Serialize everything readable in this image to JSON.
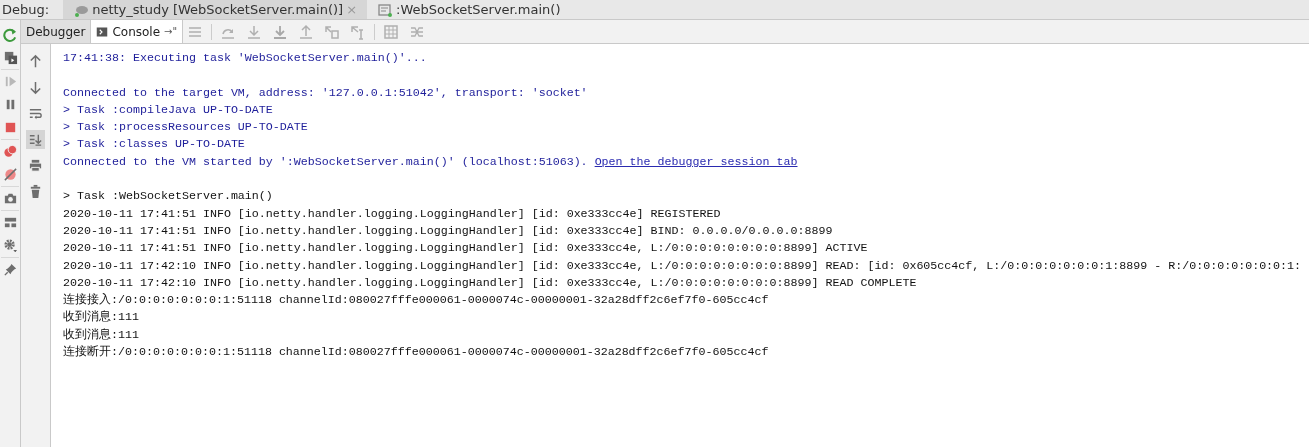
{
  "debug_bar": {
    "label": "Debug:",
    "tabs": [
      {
        "title": "netty_study [WebSocketServer.main()]",
        "selected": true,
        "close": "×"
      },
      {
        "title": ":WebSocketServer.main()",
        "selected": false
      }
    ]
  },
  "toolbar": {
    "tabs": [
      {
        "label": "Debugger",
        "selected": false
      },
      {
        "label": "Console",
        "selected": true,
        "pin": "→\""
      }
    ]
  },
  "gutter": {
    "scroll_to_end_on": true
  },
  "console": {
    "lines": [
      {
        "kind": "system",
        "text": "17:41:38: Executing task 'WebSocketServer.main()'..."
      },
      {
        "kind": "blank"
      },
      {
        "kind": "system",
        "text": "Connected to the target VM, address: '127.0.0.1:51042', transport: 'socket'"
      },
      {
        "kind": "system",
        "text": "> Task :compileJava UP-TO-DATE"
      },
      {
        "kind": "system",
        "text": "> Task :processResources UP-TO-DATE"
      },
      {
        "kind": "system",
        "text": "> Task :classes UP-TO-DATE"
      },
      {
        "kind": "system",
        "text": "Connected to the VM started by ':WebSocketServer.main()' (localhost:51063). ",
        "link": "Open the debugger session tab"
      },
      {
        "kind": "blank"
      },
      {
        "kind": "output",
        "text": "> Task :WebSocketServer.main()"
      },
      {
        "kind": "output",
        "text": "2020-10-11 17:41:51 INFO [io.netty.handler.logging.LoggingHandler] [id: 0xe333cc4e] REGISTERED"
      },
      {
        "kind": "output",
        "text": "2020-10-11 17:41:51 INFO [io.netty.handler.logging.LoggingHandler] [id: 0xe333cc4e] BIND: 0.0.0.0/0.0.0.0:8899"
      },
      {
        "kind": "output",
        "text": "2020-10-11 17:41:51 INFO [io.netty.handler.logging.LoggingHandler] [id: 0xe333cc4e, L:/0:0:0:0:0:0:0:0:8899] ACTIVE"
      },
      {
        "kind": "output",
        "text": "2020-10-11 17:42:10 INFO [io.netty.handler.logging.LoggingHandler] [id: 0xe333cc4e, L:/0:0:0:0:0:0:0:0:8899] READ: [id: 0x605cc4cf, L:/0:0:0:0:0:0:0:1:8899 - R:/0:0:0:0:0:0:0:1:"
      },
      {
        "kind": "output",
        "text": "2020-10-11 17:42:10 INFO [io.netty.handler.logging.LoggingHandler] [id: 0xe333cc4e, L:/0:0:0:0:0:0:0:0:8899] READ COMPLETE"
      },
      {
        "kind": "output",
        "text": "连接接入:/0:0:0:0:0:0:0:1:51118 channelId:080027fffe000061-0000074c-00000001-32a28dff2c6ef7f0-605cc4cf"
      },
      {
        "kind": "output",
        "text": "收到消息:111"
      },
      {
        "kind": "output",
        "text": "收到消息:111"
      },
      {
        "kind": "output",
        "text": "连接断开:/0:0:0:0:0:0:0:1:51118 channelId:080027fffe000061-0000074c-00000001-32a28dff2c6ef7f0-605cc4cf"
      }
    ]
  }
}
